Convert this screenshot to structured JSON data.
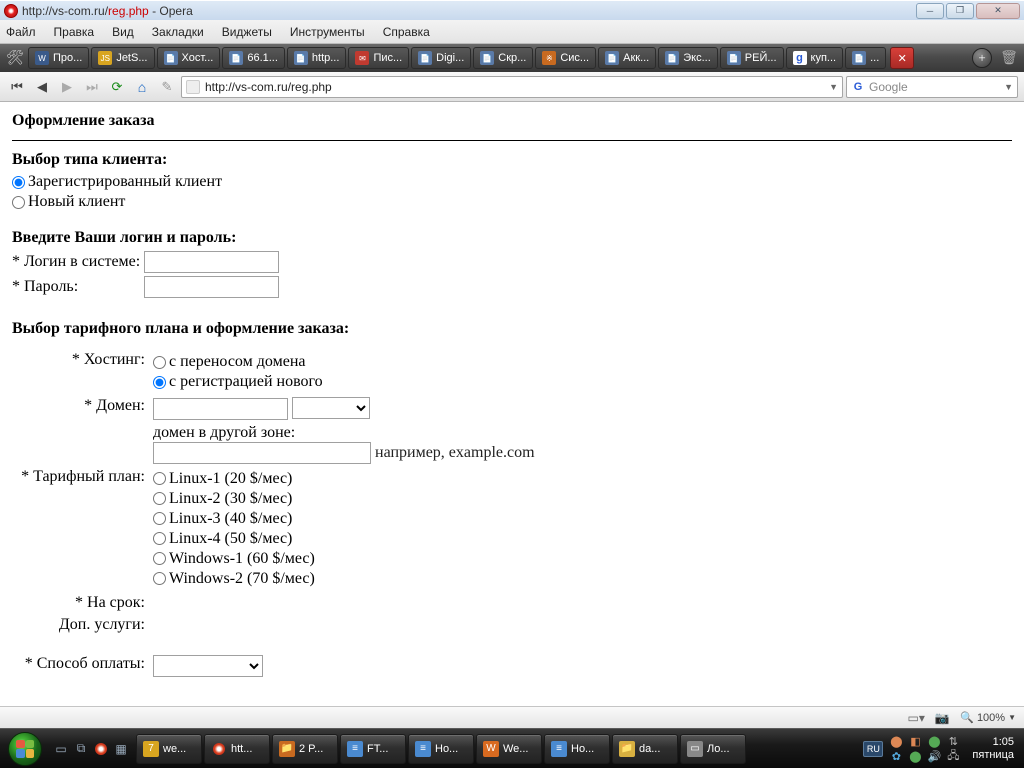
{
  "window": {
    "title_prefix": "http://vs-com.ru/",
    "title_red": "reg.php",
    "title_suffix": " - Opera"
  },
  "menu": [
    "Файл",
    "Правка",
    "Вид",
    "Закладки",
    "Виджеты",
    "Инструменты",
    "Справка"
  ],
  "tabs": [
    "Про...",
    "JetS...",
    "Хост...",
    "66.1...",
    "http...",
    "Пис...",
    "Digi...",
    "Скр...",
    "Сис...",
    "Акк...",
    "Экс...",
    "РЕЙ...",
    "куп...",
    "...",
    ""
  ],
  "nav": {
    "url": "http://vs-com.ru/reg.php",
    "search_placeholder": "Google"
  },
  "page": {
    "heading": "Оформление заказа",
    "client_type_title": "Выбор типа клиента:",
    "client_registered": "Зарегистрированный клиент",
    "client_new": "Новый клиент",
    "login_title": "Введите Ваши логин и пароль:",
    "login_label": "* Логин в системе:",
    "password_label": "* Пароль:",
    "plan_title": "Выбор тарифного плана и оформление заказа:",
    "hosting_label": "* Хостинг:",
    "hosting_transfer": "с переносом домена",
    "hosting_register": "с регистрацией нового",
    "domain_label": "* Домен:",
    "domain_other_zone": "домен в другой зоне:",
    "domain_hint": "например, example.com",
    "tariff_label": "* Тарифный план:",
    "plans": [
      "Linux-1 (20 $/мес)",
      "Linux-2 (30 $/мес)",
      "Linux-3 (40 $/мес)",
      "Linux-4 (50 $/мес)",
      "Windows-1 (60 $/мес)",
      "Windows-2 (70 $/мес)"
    ],
    "term_label": "* На срок:",
    "extra_label": "Доп. услуги:",
    "payment_label": "* Способ оплаты:"
  },
  "statusbar": {
    "zoom": "100%"
  },
  "taskbar": {
    "items": [
      "we...",
      "htt...",
      "2 P...",
      "FT...",
      "Ho...",
      "We...",
      "Ho...",
      "da...",
      "Ло..."
    ],
    "lang": "RU",
    "time": "1:05",
    "day": "пятница"
  }
}
